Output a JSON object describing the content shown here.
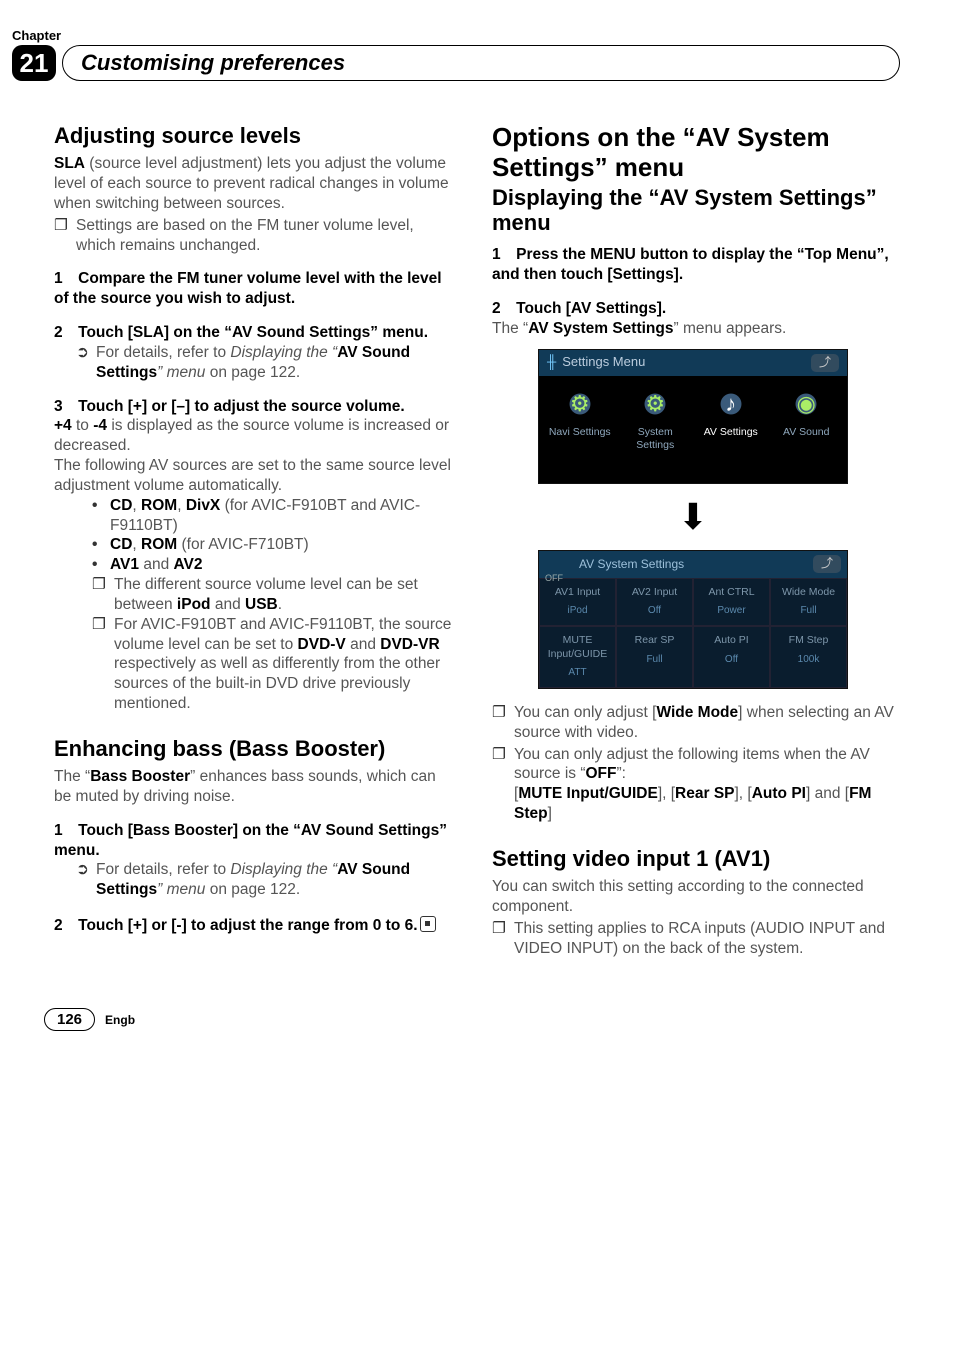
{
  "header": {
    "chapter_label": "Chapter",
    "chapter_number": "21",
    "title": "Customising preferences"
  },
  "col1": {
    "s1_title": "Adjusting source levels",
    "s1_intro_a": "SLA",
    "s1_intro_b": " (source level adjustment) lets you adjust the volume level of each source to prevent radical changes in volume when switching between sources.",
    "s1_note": "Settings are based on the FM tuner volume level, which remains unchanged.",
    "s1_step1": "1 Compare the FM tuner volume level with the level of the source you wish to adjust.",
    "s1_step2": "2 Touch [SLA] on the “AV Sound Settings” menu.",
    "s1_ref_a": "For details, refer to ",
    "s1_ref_b": "Displaying the “",
    "s1_ref_c": "AV Sound Settings",
    "s1_ref_d": "” menu",
    "s1_ref_e": " on page 122.",
    "s1_step3": "3 Touch [+] or [–] to adjust the source volume.",
    "s1_range_a": "+4",
    "s1_range_b": " to ",
    "s1_range_c": "-4",
    "s1_range_d": " is displayed as the source volume is increased or decreased.",
    "s1_follow": "The following AV sources are set to the same source level adjustment volume automatically.",
    "s1_b1_a": "CD",
    "s1_b1_b": ", ",
    "s1_b1_c": "ROM",
    "s1_b1_d": ", ",
    "s1_b1_e": "DivX",
    "s1_b1_f": " (for AVIC-F910BT and AVIC-F9110BT)",
    "s1_b2_a": "CD",
    "s1_b2_b": ", ",
    "s1_b2_c": "ROM",
    "s1_b2_d": " (for AVIC-F710BT)",
    "s1_b3_a": "AV1",
    "s1_b3_b": " and ",
    "s1_b3_c": "AV2",
    "s1_sub1_a": "The different source volume level can be set between ",
    "s1_sub1_b": "iPod",
    "s1_sub1_c": " and ",
    "s1_sub1_d": "USB",
    "s1_sub1_e": ".",
    "s1_sub2_a": "For AVIC-F910BT and AVIC-F9110BT, the source volume level can be set to ",
    "s1_sub2_b": "DVD-V",
    "s1_sub2_c": " and ",
    "s1_sub2_d": "DVD-VR",
    "s1_sub2_e": " respectively as well as differently from the other sources of the built-in DVD drive previously mentioned.",
    "s2_title_a": "Enhancing bass (",
    "s2_title_b": "Bass Booster",
    "s2_title_c": ")",
    "s2_intro_a": "The “",
    "s2_intro_b": "Bass Booster",
    "s2_intro_c": "” enhances bass sounds, which can be muted by driving noise.",
    "s2_step1": "1 Touch [Bass Booster] on the “AV Sound Settings” menu.",
    "s2_step2": "2 Touch [+] or [-] to adjust the range from 0 to 6."
  },
  "col2": {
    "h1_a": "Options on the “",
    "h1_b": "AV System Settings",
    "h1_c": "” menu",
    "h2_a": "Displaying the “",
    "h2_b": "AV System Settings",
    "h2_c": "” menu",
    "step1": "1 Press the MENU button to display the “Top Menu”, and then touch [Settings].",
    "step2": "2 Touch [AV Settings].",
    "res_a": "The “",
    "res_b": "AV System Settings",
    "res_c": "” menu appears.",
    "scr1_title": "Settings Menu",
    "scr1_tiles": [
      "Navi Settings",
      "System Settings",
      "AV Settings",
      "AV Sound"
    ],
    "scr2_title": "AV System Settings",
    "scr2_off": "OFF",
    "scr2_grid": [
      {
        "t": "AV1 Input",
        "s": "iPod"
      },
      {
        "t": "AV2 Input",
        "s": "Off"
      },
      {
        "t": "Ant CTRL",
        "s": "Power"
      },
      {
        "t": "Wide Mode",
        "s": "Full"
      },
      {
        "t": "MUTE Input/GUIDE",
        "s": "ATT"
      },
      {
        "t": "Rear SP",
        "s": "Full"
      },
      {
        "t": "Auto PI",
        "s": "Off"
      },
      {
        "t": "FM Step",
        "s": "100k"
      }
    ],
    "note1_a": "You can only adjust [",
    "note1_b": "Wide Mode",
    "note1_c": "] when selecting an AV source with video.",
    "note2_a": "You can only adjust the following items when the AV source is “",
    "note2_b": "OFF",
    "note2_c": "”:",
    "note2_list_a": "[",
    "note2_list_b": "MUTE Input/GUIDE",
    "note2_list_c": "], [",
    "note2_list_d": "Rear SP",
    "note2_list_e": "], [",
    "note2_list_f": "Auto PI",
    "note2_list_g": "] and [",
    "note2_list_h": "FM Step",
    "note2_list_i": "]",
    "s3_title_a": "Setting video input 1 (",
    "s3_title_b": "AV1",
    "s3_title_c": ")",
    "s3_intro": "You can switch this setting according to the connected component.",
    "s3_note": "This setting applies to RCA inputs (AUDIO INPUT and VIDEO INPUT) on the back of the system."
  },
  "footer": {
    "page": "126",
    "lang": "Engb"
  }
}
